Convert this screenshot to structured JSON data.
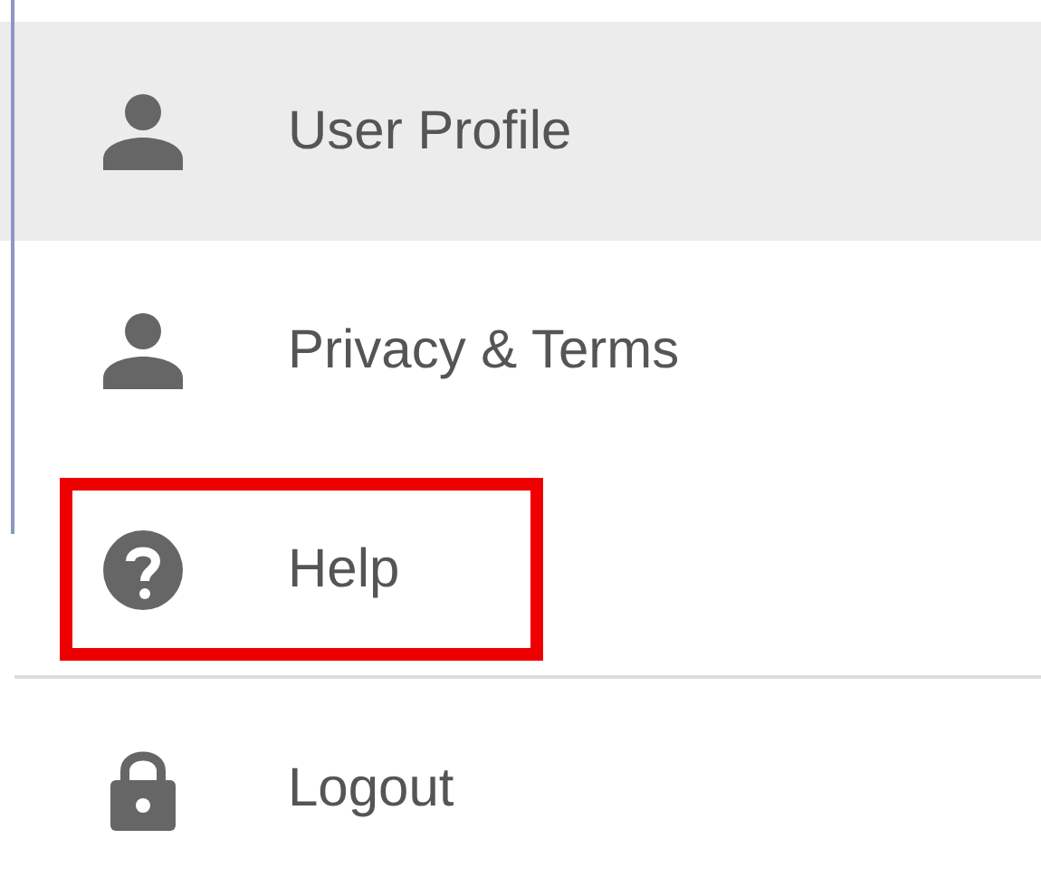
{
  "menu": {
    "items": [
      {
        "label": "User Profile",
        "selected": true,
        "highlighted": false
      },
      {
        "label": "Privacy & Terms",
        "selected": false,
        "highlighted": false
      },
      {
        "label": "Help",
        "selected": false,
        "highlighted": true
      },
      {
        "label": "Logout",
        "selected": false,
        "highlighted": false
      }
    ]
  }
}
